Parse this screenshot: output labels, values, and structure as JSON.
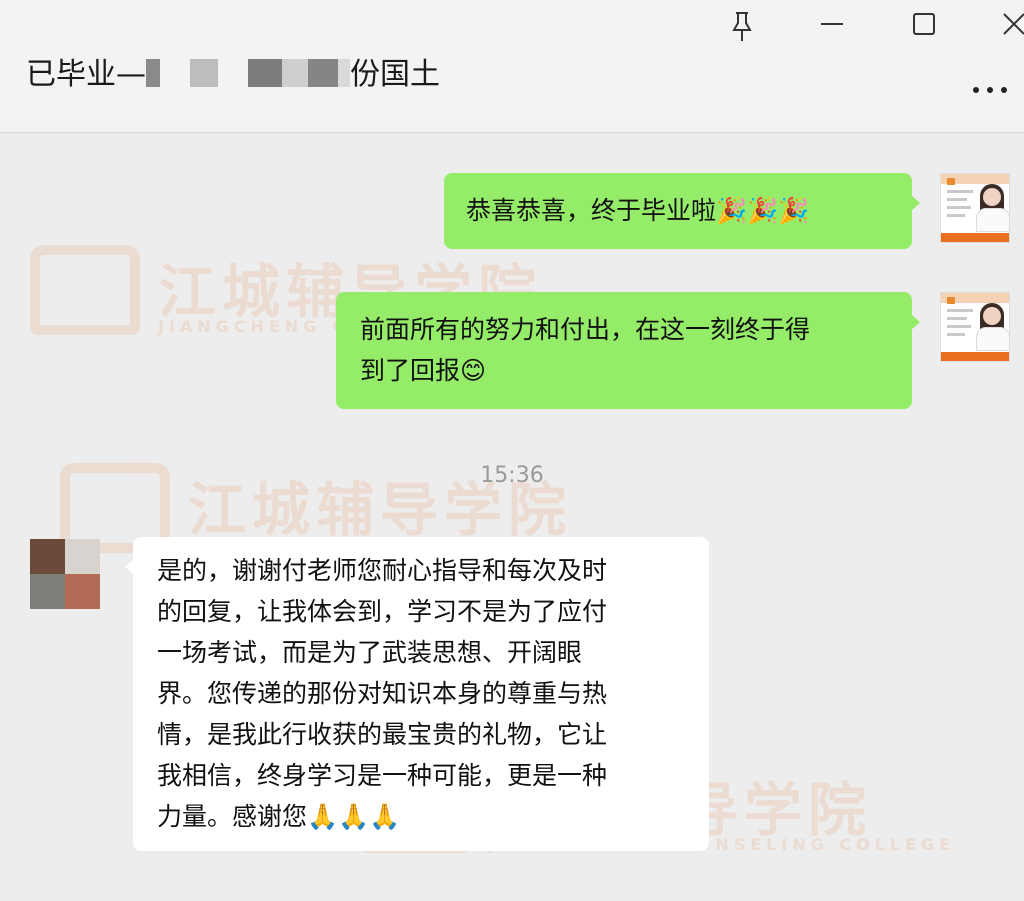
{
  "window": {
    "title_start": "已毕业—",
    "title_end": "份国土"
  },
  "messages": [
    {
      "from": "self",
      "text": "恭喜恭喜，终于毕业啦",
      "emoji": "🎉🎉🎉"
    },
    {
      "from": "self",
      "line1": "前面所有的努力和付出，在这一刻终于得",
      "line2": "到了回报",
      "emoji": "😊"
    },
    {
      "from": "other",
      "lines": [
        "是的，谢谢付老师您耐心指导和每次及时",
        "的回复，让我体会到，学习不是为了应付",
        "一场考试，而是为了武装思想、开阔眼",
        "界。您传递的那份对知识本身的尊重与热",
        "情，是我此行收获的最宝贵的礼物，它让",
        "我相信，终身学习是一种可能，更是一种",
        "力量。感谢您"
      ],
      "emoji": "🙏🙏🙏"
    }
  ],
  "timestamp": "15:36",
  "watermark": {
    "name": "江城辅导学院",
    "subtitle": "JIANGCHENG COUNSELING COLLEGE"
  },
  "icons": {
    "pin": "pin-icon",
    "minimize": "minimize-icon",
    "maximize": "maximize-icon",
    "close": "close-icon",
    "more": "more-icon"
  },
  "colors": {
    "sent_bubble": "#95ec69",
    "received_bubble": "#ffffff",
    "chat_background": "#ededed",
    "watermark_orange": "#e06a1f"
  }
}
